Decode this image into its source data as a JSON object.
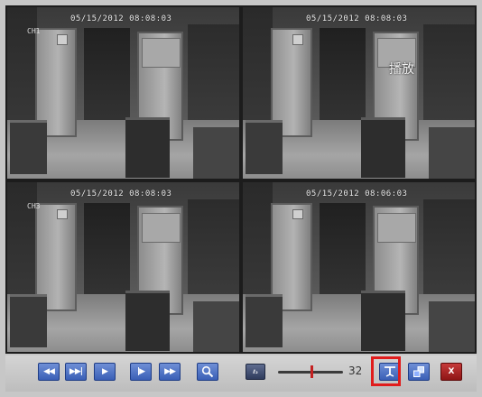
{
  "cameras": [
    {
      "timestamp": "05/15/2012 08:08:03",
      "channel": "CH1",
      "overlay": ""
    },
    {
      "timestamp": "05/15/2012 08:08:03",
      "channel": "",
      "overlay": "播放"
    },
    {
      "timestamp": "05/15/2012 08:08:03",
      "channel": "CH3",
      "overlay": ""
    },
    {
      "timestamp": "05/15/2012 08:06:03",
      "channel": "",
      "overlay": ""
    }
  ],
  "controls": {
    "rewind_label": "◀◀",
    "step_label": "▶▶|",
    "play_label": "▶",
    "frame_label": "|▶",
    "ff_label": "▶▶",
    "zoom_icon": "magnifier-icon",
    "speed_label": "ℓ₂",
    "slider": {
      "value": 32,
      "max": 64
    },
    "cut_icon": "clip-icon",
    "fullscreen_icon": "fullscreen-icon",
    "close_label": "X"
  },
  "colors": {
    "button": "#3a5fb6",
    "close": "#8e1515",
    "highlight": "#e01c1c"
  }
}
